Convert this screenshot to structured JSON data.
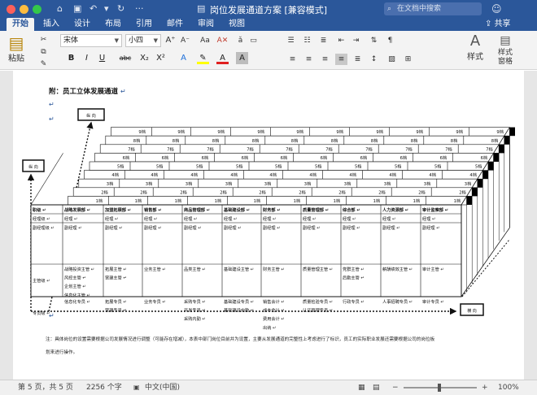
{
  "titlebar": {
    "window_title": "岗位发展通道方案 [兼容模式]",
    "search_placeholder": "在文档中搜索"
  },
  "tabs": [
    "开始",
    "插入",
    "设计",
    "布局",
    "引用",
    "邮件",
    "审阅",
    "视图"
  ],
  "share_label": "共享",
  "ribbon": {
    "paste_label": "粘贴",
    "font_name": "宋体",
    "font_size": "小四",
    "styles_label": "样式",
    "styles_pane_label_1": "样式",
    "styles_pane_label_2": "窗格",
    "font_buttons": [
      "B",
      "I",
      "U",
      "abc",
      "X₂",
      "X²",
      "A",
      "A",
      "A"
    ],
    "case_button": "Aa"
  },
  "document": {
    "heading": "附：员工立体发展通道",
    "para_mark": "↵",
    "box_top": "纵 向",
    "box_left": "纵 向",
    "box_right": "横 向",
    "note": "注：具体岗位的设置需要根据公司发展情况进行调整（可能存在增减），本表中部门岗位目前并为设置，主要从发展通道的完整性上考虑进行了标识，员工的实际职业发展还需要根据公司的岗位板",
    "note_line2": "划来进行操作。",
    "grade_labels": [
      "9档",
      "8档",
      "7档",
      "6档",
      "5档",
      "4档",
      "3档",
      "2档",
      "1档"
    ],
    "table": {
      "headers": [
        "职级",
        "战略发展部",
        "加盟拓展部",
        "销售部",
        "商品管理部",
        "基础建设部",
        "财务部",
        "质量管理部",
        "综合部",
        "人力资源部",
        "审计监察部"
      ],
      "rows": [
        {
          "level": "经理级",
          "cells": [
            "经理",
            "经理",
            "经理",
            "经理",
            "经理",
            "经理",
            "经理",
            "经理",
            "经理",
            "经理"
          ]
        },
        {
          "level": "副经理级",
          "cells": [
            "副经理",
            "副经理",
            "副经理",
            "副经理",
            "副经理",
            "副经理",
            "副经理",
            "副经理",
            "副经理",
            "副经理"
          ]
        },
        {
          "level": "主管级",
          "cells": [
            [
              "战略投资主管",
              "风控主管",
              "企划主管",
              "信息化主管"
            ],
            [
              "拓展主管",
              "营建主管"
            ],
            [
              "业务主管"
            ],
            [
              "品类主管"
            ],
            [
              "基础建设主管"
            ],
            [
              "财务主管"
            ],
            [
              "质量管理主管"
            ],
            [
              "党群主管",
              "后勤主管"
            ],
            [
              "薪酬绩效主管"
            ],
            [
              "审计主管"
            ]
          ]
        },
        {
          "level": "专员级",
          "cells": [
            [
              "信息化专员"
            ],
            [
              "拓展专员",
              "营建专员"
            ],
            [
              "业务专员"
            ],
            [
              "采购专员",
              "开发专员",
              "采购内勤"
            ],
            [
              "基础建设专员",
              "基础建设内勤"
            ],
            [
              "销售会计",
              "成本会计",
              "费用会计",
              "出纳"
            ],
            [
              "质量检验专员",
              "认证管理专员"
            ],
            [
              "行政专员"
            ],
            [
              "人事招聘专员"
            ],
            [
              "审计专员"
            ]
          ]
        }
      ]
    }
  },
  "status": {
    "pages": "第 5 页，共 5 页",
    "words": "2256 个字",
    "language": "中文(中国)",
    "zoom": "100%"
  },
  "colors": {
    "brand": "#2b579a",
    "ribbon": "#f3f3f3",
    "close": "#fc605b",
    "minimize": "#fdbc40",
    "maximize": "#34c84a"
  }
}
